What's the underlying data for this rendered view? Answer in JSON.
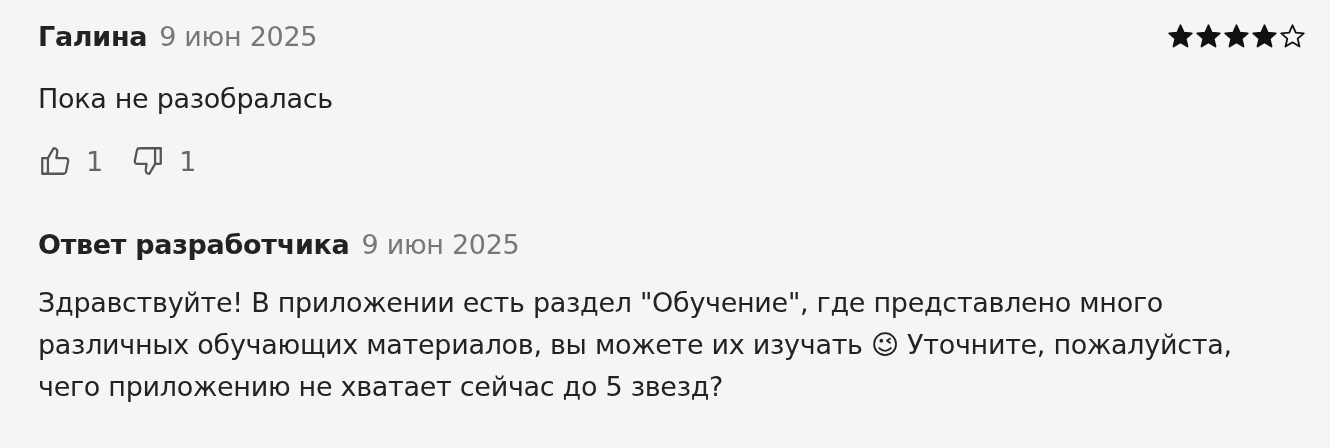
{
  "review": {
    "author": "Галина",
    "date": "9 июн 2025",
    "stars": 4,
    "text": "Пока не разобралась",
    "likes": "1",
    "dislikes": "1"
  },
  "developer_reply": {
    "title": "Ответ разработчика",
    "date": "9 июн 2025",
    "text": "Здравствуйте! В приложении есть раздел \"Обучение\", где представлено много различных обучающих материалов, вы можете их изучать 😉 Уточните, пожалуйста, чего приложению не хватает сейчас до 5 звезд?"
  }
}
